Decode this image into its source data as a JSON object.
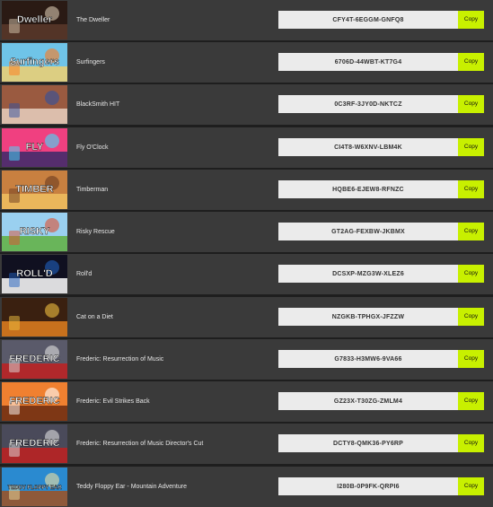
{
  "copy_label": "Copy",
  "items": [
    {
      "title": "The Dweller",
      "key": "CFY4T-6EGGM-GNFQ8",
      "thumb_text": "Dweller",
      "thumb_colors": [
        "#2a1a14",
        "#5a3a2a",
        "#d8c8b0"
      ],
      "thumb_icon": "dweller-art-icon"
    },
    {
      "title": "Surfingers",
      "key": "6706D-44WBT-KT7G4",
      "thumb_text": "Surfingers",
      "thumb_colors": [
        "#6fc4e8",
        "#f0d070",
        "#ff7a1a"
      ],
      "thumb_icon": "surfingers-art-icon"
    },
    {
      "title": "BlackSmith HIT",
      "key": "0C3RF-3JY0D-NKTCZ",
      "thumb_text": "",
      "thumb_colors": [
        "#9a5a40",
        "#e8d0c0",
        "#3050a0"
      ],
      "thumb_icon": "blacksmith-art-icon"
    },
    {
      "title": "Fly O'Clock",
      "key": "CI4T8-W6XNV-LBM4K",
      "thumb_text": "FLY",
      "thumb_colors": [
        "#f04080",
        "#3a2a6a",
        "#40e0ff"
      ],
      "thumb_icon": "fly-oclock-art-icon"
    },
    {
      "title": "Timberman",
      "key": "HQBE6-EJEW8-RFNZC",
      "thumb_text": "TIMBER",
      "thumb_colors": [
        "#c88040",
        "#f0c060",
        "#6a3a20"
      ],
      "thumb_icon": "timberman-art-icon"
    },
    {
      "title": "Risky Rescue",
      "key": "GT2AG-FEXBW-JKBMX",
      "thumb_text": "RISKY",
      "thumb_colors": [
        "#9ad0f0",
        "#60b040",
        "#e05030"
      ],
      "thumb_icon": "risky-rescue-art-icon"
    },
    {
      "title": "Roll'd",
      "key": "DCSXP-MZG3W-XLEZ6",
      "thumb_text": "ROLL'D",
      "thumb_colors": [
        "#101020",
        "#ffffff",
        "#2060c0"
      ],
      "thumb_icon": "rolld-art-icon"
    },
    {
      "title": "Cat on a Diet",
      "key": "NZGKB-TPHGX-JFZZW",
      "thumb_text": "",
      "thumb_colors": [
        "#3a2010",
        "#e08020",
        "#f0c040"
      ],
      "thumb_icon": "cat-on-a-diet-art-icon"
    },
    {
      "title": "Frederic: Resurrection of Music",
      "key": "G7833-H3MW6-9VA66",
      "thumb_text": "FREDERIC",
      "thumb_colors": [
        "#5a5a6a",
        "#c02020",
        "#e0e0e0"
      ],
      "thumb_icon": "frederic-art-icon"
    },
    {
      "title": "Frederic: Evil Strikes Back",
      "key": "GZ23X-T30ZG-ZMLM4",
      "thumb_text": "FREDERIC",
      "thumb_colors": [
        "#f08030",
        "#6a2a10",
        "#ffffff"
      ],
      "thumb_icon": "frederic-evil-art-icon"
    },
    {
      "title": "Frederic: Resurrection of Music Director's Cut",
      "key": "DCTY8-QMK36-PY6RP",
      "thumb_text": "FREDERIC",
      "thumb_colors": [
        "#4a4a5a",
        "#c02020",
        "#e0e0e0"
      ],
      "thumb_icon": "frederic-dc-art-icon"
    },
    {
      "title": "Teddy Floppy Ear - Mountain Adventure",
      "key": "I280B-0P9FK-QRPI6",
      "thumb_text": "TEDDY FLOPPY EAR",
      "thumb_colors": [
        "#2a8ad0",
        "#a05020",
        "#f0e0a0"
      ],
      "thumb_icon": "teddy-floppy-ear-art-icon"
    }
  ]
}
